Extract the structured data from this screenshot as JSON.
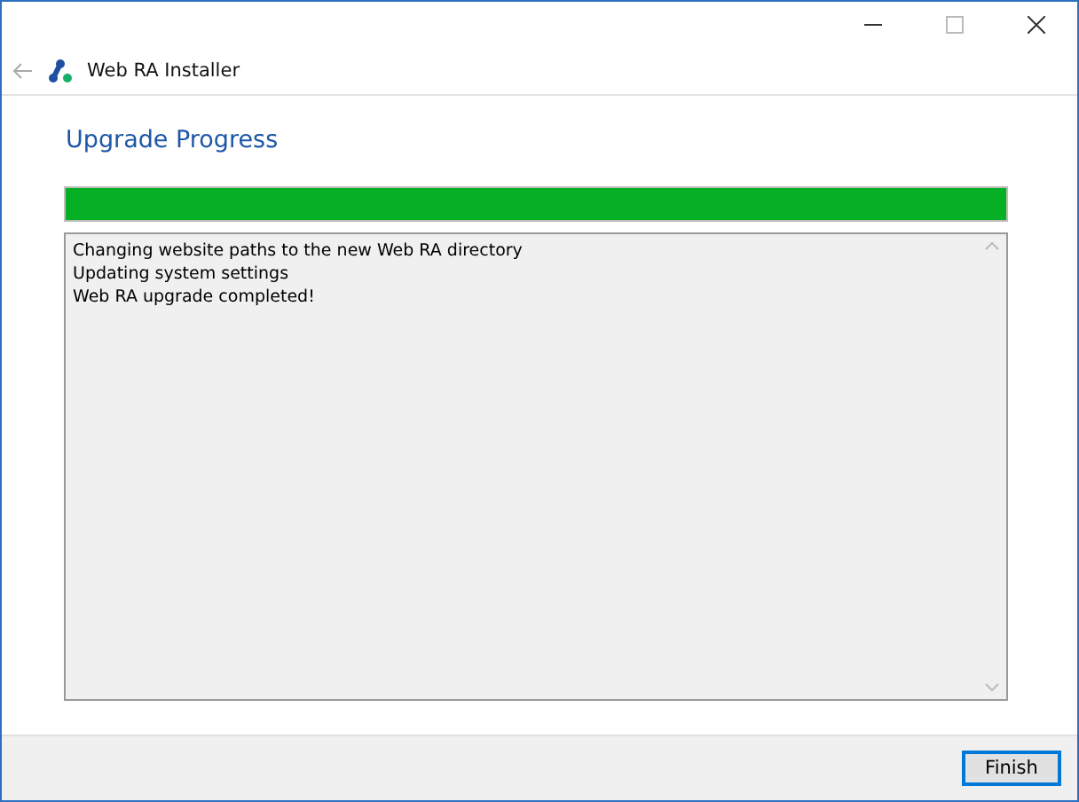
{
  "window": {
    "title": "Web RA Installer"
  },
  "heading": "Upgrade Progress",
  "progress": {
    "level": 1
  },
  "log": [
    "Changing website paths to the new Web RA directory",
    "Updating system settings",
    "Web RA upgrade completed!"
  ],
  "buttons": [
    {
      "label": "Finish",
      "focused": true
    }
  ]
}
